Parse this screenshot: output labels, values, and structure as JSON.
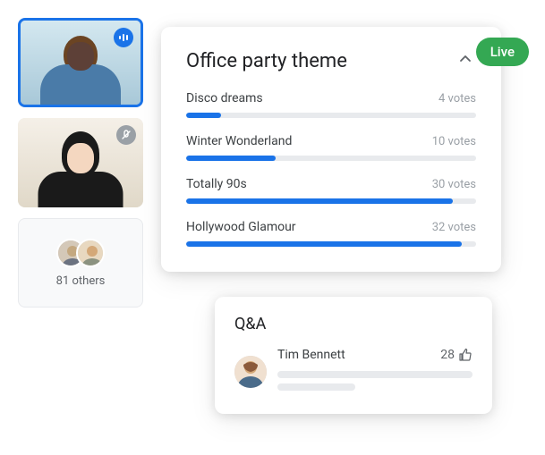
{
  "live_badge": "Live",
  "poll": {
    "title": "Office party theme",
    "options": [
      {
        "label": "Disco dreams",
        "votes": "4 votes",
        "percent": 12
      },
      {
        "label": "Winter Wonderland",
        "votes": "10 votes",
        "percent": 31
      },
      {
        "label": "Totally 90s",
        "votes": "30 votes",
        "percent": 92
      },
      {
        "label": "Hollywood Glamour",
        "votes": "32 votes",
        "percent": 95
      }
    ]
  },
  "others": {
    "text": "81 others"
  },
  "qa": {
    "title": "Q&A",
    "name": "Tim Bennett",
    "upvotes": "28"
  },
  "chart_data": {
    "type": "bar",
    "title": "Office party theme",
    "categories": [
      "Disco dreams",
      "Winter Wonderland",
      "Totally 90s",
      "Hollywood Glamour"
    ],
    "values": [
      4,
      10,
      30,
      32
    ],
    "ylabel": "votes",
    "ylim": [
      0,
      35
    ]
  }
}
